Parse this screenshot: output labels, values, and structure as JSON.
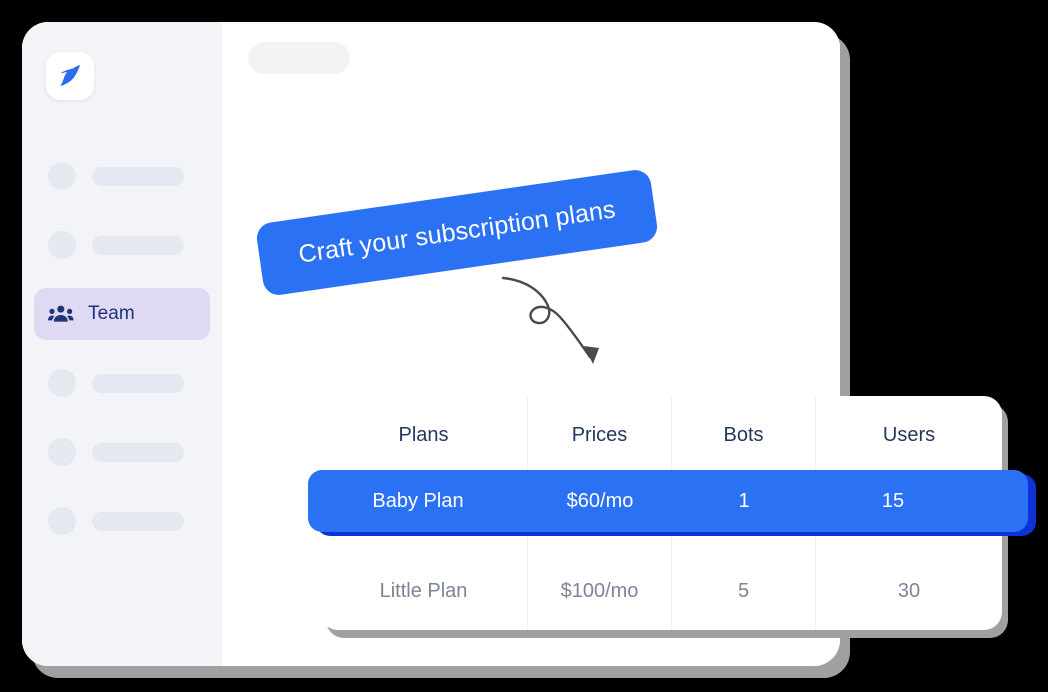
{
  "app": {
    "logo_icon": "bird-logo-icon",
    "brand_color": "#2B71F3"
  },
  "sidebar": {
    "background_color": "#F2F4F7",
    "items": [
      {
        "label": "",
        "icon": "placeholder-icon",
        "state": "skeleton"
      },
      {
        "label": "",
        "icon": "placeholder-icon",
        "state": "skeleton"
      },
      {
        "label": "Team",
        "icon": "team-group-icon",
        "state": "active"
      },
      {
        "label": "",
        "icon": "placeholder-icon",
        "state": "skeleton"
      },
      {
        "label": "",
        "icon": "placeholder-icon",
        "state": "skeleton"
      },
      {
        "label": "",
        "icon": "placeholder-icon",
        "state": "skeleton"
      }
    ],
    "active_background_color": "#DFD9F3",
    "active_text_color": "#1E337A"
  },
  "content": {
    "placeholder_label": ""
  },
  "callout": {
    "text": "Craft your subscription plans",
    "background_color": "#2B71F3",
    "text_color": "#FFFFFF",
    "arrow_icon": "curly-arrow-icon"
  },
  "table": {
    "columns": [
      "Plans",
      "Prices",
      "Bots",
      "Users"
    ],
    "rows": [
      {
        "plan": "Baby Plan",
        "price": "$60/mo",
        "bots": "1",
        "users": "15",
        "highlighted": true
      },
      {
        "plan": "Little Plan",
        "price": "$100/mo",
        "bots": "5",
        "users": "30",
        "highlighted": false
      }
    ],
    "highlight_color": "#2B71F3",
    "highlight_shadow_color": "#0B33D6",
    "header_text_color": "#24375F",
    "body_text_color": "#7C8596"
  }
}
